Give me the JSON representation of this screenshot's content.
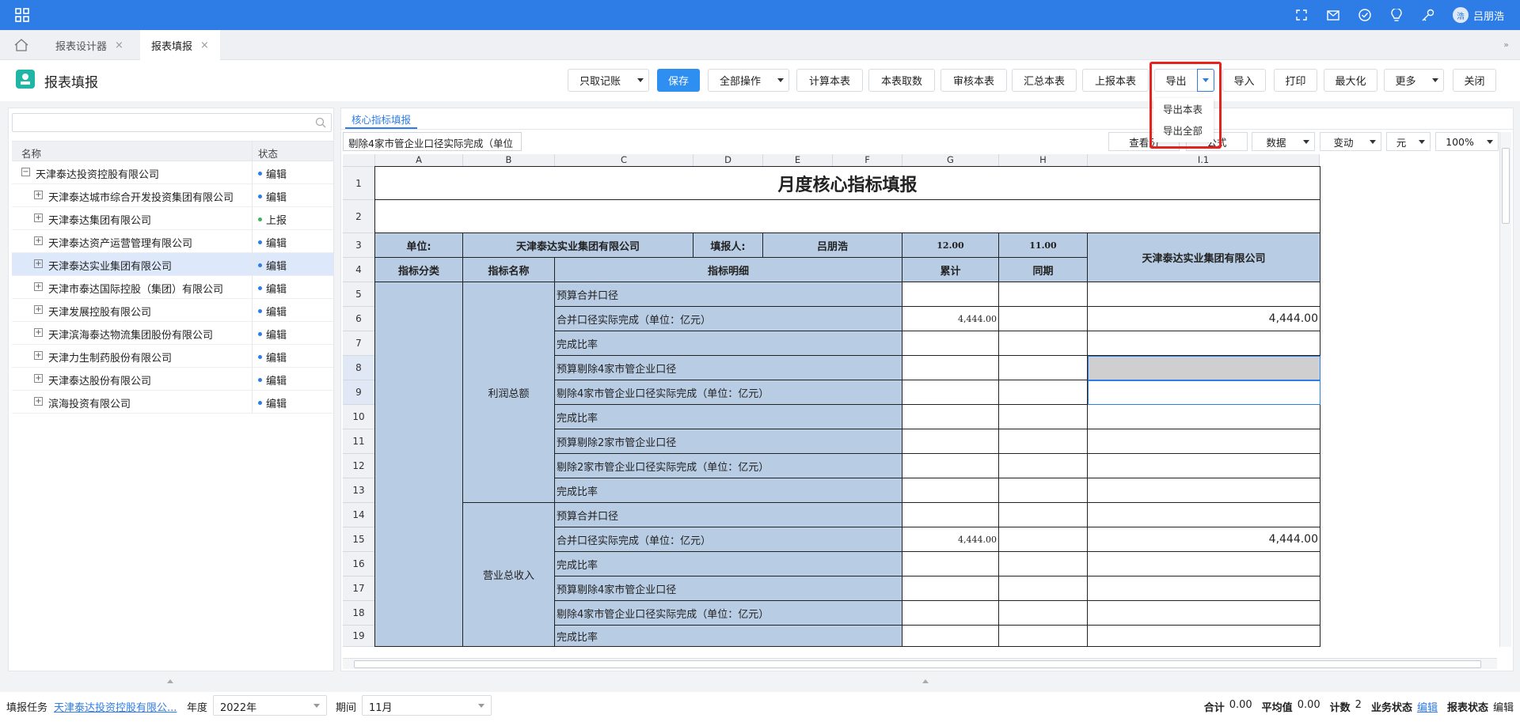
{
  "topbar": {
    "user_initial": "浩",
    "user_name": "吕朋浩"
  },
  "tabs": [
    {
      "label": "报表设计器"
    },
    {
      "label": "报表填报"
    }
  ],
  "header": {
    "title": "报表填报"
  },
  "toolbar": {
    "zhiqu": "只取记账",
    "save": "保存",
    "all_ops": "全部操作",
    "calc": "计算本表",
    "fetch": "本表取数",
    "audit": "审核本表",
    "summary": "汇总本表",
    "report": "上报本表",
    "export": "导出",
    "import": "导入",
    "print": "打印",
    "maximize": "最大化",
    "more": "更多",
    "close": "关闭"
  },
  "export_menu": [
    "导出本表",
    "导出全部"
  ],
  "tree": {
    "search_placeholder": "",
    "col_name": "名称",
    "col_status": "状态",
    "rows": [
      {
        "name": "天津泰达投资控股有限公司",
        "status": "编辑",
        "level": 0,
        "expanded": true
      },
      {
        "name": "天津泰达城市综合开发投资集团有限公司",
        "status": "编辑",
        "level": 1
      },
      {
        "name": "天津泰达集团有限公司",
        "status": "上报",
        "level": 1
      },
      {
        "name": "天津泰达资产运营管理有限公司",
        "status": "编辑",
        "level": 1
      },
      {
        "name": "天津泰达实业集团有限公司",
        "status": "编辑",
        "level": 1,
        "selected": true
      },
      {
        "name": "天津市泰达国际控股（集团）有限公司",
        "status": "编辑",
        "level": 1
      },
      {
        "name": "天津发展控股有限公司",
        "status": "编辑",
        "level": 1
      },
      {
        "name": "天津滨海泰达物流集团股份有限公司",
        "status": "编辑",
        "level": 1
      },
      {
        "name": "天津力生制药股份有限公司",
        "status": "编辑",
        "level": 1
      },
      {
        "name": "天津泰达股份有限公司",
        "status": "编辑",
        "level": 1
      },
      {
        "name": "滨海投资有限公司",
        "status": "编辑",
        "level": 1
      }
    ]
  },
  "sheet": {
    "tab": "核心指标填报",
    "formula_value": "剔除4家市管企业口径实际完成（单位",
    "right_tools": {
      "history": "查看历",
      "formula": "公式",
      "data": "数据",
      "change": "变动",
      "unit": "元",
      "zoom": "100%"
    },
    "columns": [
      "A",
      "B",
      "C",
      "D",
      "E",
      "F",
      "G",
      "H",
      "I.1"
    ],
    "rows": [
      "1",
      "2",
      "3",
      "4",
      "5",
      "6",
      "7",
      "8",
      "9",
      "10",
      "11",
      "12",
      "13",
      "14",
      "15",
      "16",
      "17",
      "18",
      "19"
    ],
    "title": "月度核心指标填报",
    "unit_label": "单位:",
    "unit_value": "天津泰达实业集团有限公司",
    "filler_label": "填报人:",
    "filler_value": "吕朋浩",
    "g3": "12.00",
    "h3": "11.00",
    "i_company": "天津泰达实业集团有限公司",
    "h_cat": "指标分类",
    "h_name": "指标名称",
    "h_detail": "指标明细",
    "h_cum": "累计",
    "h_same": "同期",
    "group1": "利润总额",
    "group2": "营业总收入",
    "details": [
      "预算合并口径",
      "合并口径实际完成（单位：亿元）",
      "完成比率",
      "预算剔除4家市管企业口径",
      "剔除4家市管企业口径实际完成（单位：亿元）",
      "完成比率",
      "预算剔除2家市管企业口径",
      "剔除2家市管企业口径实际完成（单位：亿元）",
      "完成比率",
      "预算合并口径",
      "合并口径实际完成（单位：亿元）",
      "完成比率",
      "预算剔除4家市管企业口径",
      "剔除4家市管企业口径实际完成（单位：亿元）",
      "完成比率"
    ],
    "g6": "4,444.00",
    "i6": "4,444.00",
    "g15": "4,444.00",
    "i15": "4,444.00"
  },
  "status": {
    "task_label": "填报任务",
    "task_value": "天津泰达投资控股有限公...",
    "year_label": "年度",
    "year_value": "2022年",
    "period_label": "期间",
    "period_value": "11月",
    "sum_label": "合计",
    "sum": "0.00",
    "avg_label": "平均值",
    "avg": "0.00",
    "count_label": "计数",
    "count": "2",
    "biz_label": "业务状态",
    "biz": "编辑",
    "report_label": "报表状态",
    "report": "编辑"
  }
}
